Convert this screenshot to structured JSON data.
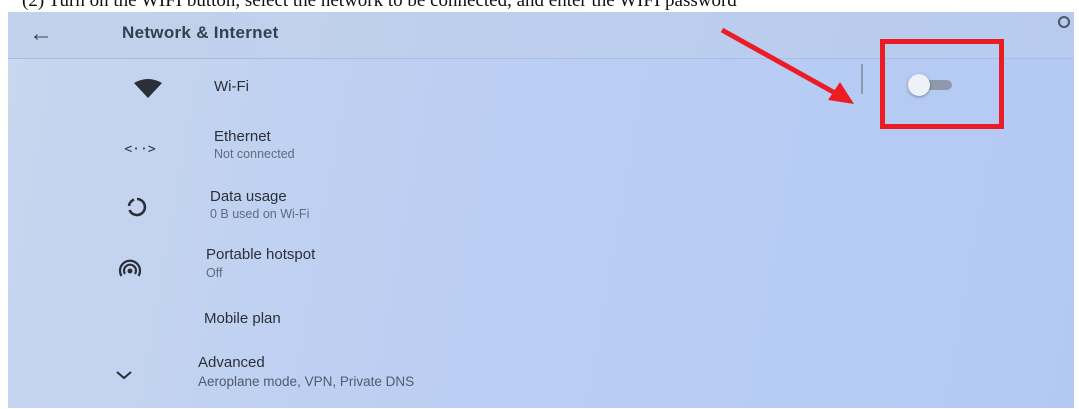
{
  "caption": "(2) Turn on the WIFI button, select the network to be connected, and enter the WIFI password",
  "header": {
    "title": "Network & Internet",
    "back_icon": "arrow-left-icon"
  },
  "items": [
    {
      "label": "Wi-Fi",
      "sub": "",
      "icon": "wifi-icon"
    },
    {
      "label": "Ethernet",
      "sub": "Not connected",
      "icon": "ethernet-icon"
    },
    {
      "label": "Data usage",
      "sub": "0 B used on Wi-Fi",
      "icon": "data-usage-icon"
    },
    {
      "label": "Portable hotspot",
      "sub": "Off",
      "icon": "hotspot-icon"
    },
    {
      "label": "Mobile plan",
      "sub": "",
      "icon": ""
    },
    {
      "label": "Advanced",
      "sub": "Aeroplane mode, VPN, Private DNS",
      "icon": "chevron-down-icon"
    }
  ],
  "wifi_toggle": {
    "state": "off"
  },
  "colors": {
    "annotation": "#ec1c24",
    "background": "#b9cdf2",
    "text": "#2b2f36",
    "secondary_text": "#5f6b7e"
  }
}
